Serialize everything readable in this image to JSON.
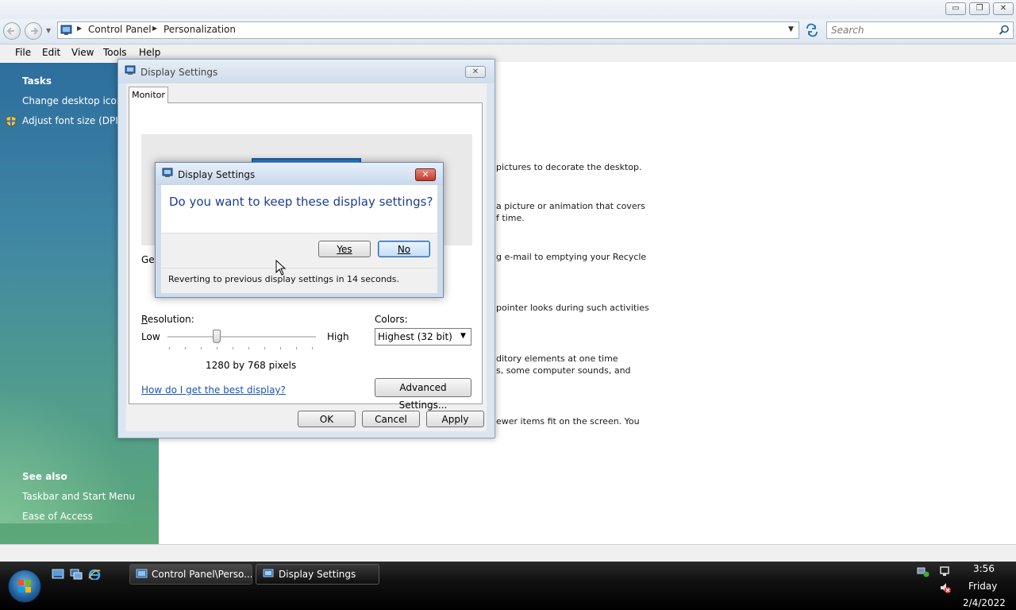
{
  "window": {
    "breadcrumb": [
      "Control Panel",
      "Personalization"
    ],
    "search_placeholder": "Search",
    "caption_buttons": [
      "▭",
      "❐",
      "✕"
    ]
  },
  "menu": [
    "File",
    "Edit",
    "View",
    "Tools",
    "Help"
  ],
  "left_pane": {
    "tasks_heading": "Tasks",
    "tasks": [
      "Change desktop icons",
      "Adjust font size (DPI)"
    ],
    "see_also_heading": "See also",
    "see_also": [
      "Taskbar and Start Menu",
      "Ease of Access"
    ]
  },
  "content_fragments": [
    "pictures to decorate the desktop.",
    "a picture or animation that covers",
    "f time.",
    "g e-mail to emptying your Recycle",
    "pointer looks during such activities",
    "ditory elements at one time",
    "s, some computer sounds, and",
    "ewer items fit on the screen. You"
  ],
  "display_settings": {
    "title": "Display Settings",
    "tab": "Monitor",
    "general_fragment": "Ger",
    "resolution_label": "Resolution:",
    "low": "Low",
    "high": "High",
    "resolution_value": "1280 by 768 pixels",
    "resolution_slider_position": 0.33,
    "colors_label": "Colors:",
    "colors_value": "Highest (32 bit)",
    "help_link": "How do I get the best display?",
    "advanced_button": "Advanced Settings...",
    "ok": "OK",
    "cancel": "Cancel",
    "apply": "Apply"
  },
  "confirm": {
    "title": "Display Settings",
    "question": "Do you want to keep these display settings?",
    "yes": "Yes",
    "no": "No",
    "revert_message": "Reverting to previous display settings in 14 seconds."
  },
  "taskbar": {
    "tasks": [
      "Control Panel\\Perso...",
      "Display Settings"
    ],
    "time": "3:56",
    "day": "Friday",
    "date": "2/4/2022"
  },
  "colors": {
    "accent": "#2a7fd4",
    "link": "#1a56b0",
    "question": "#1c3e8a"
  }
}
